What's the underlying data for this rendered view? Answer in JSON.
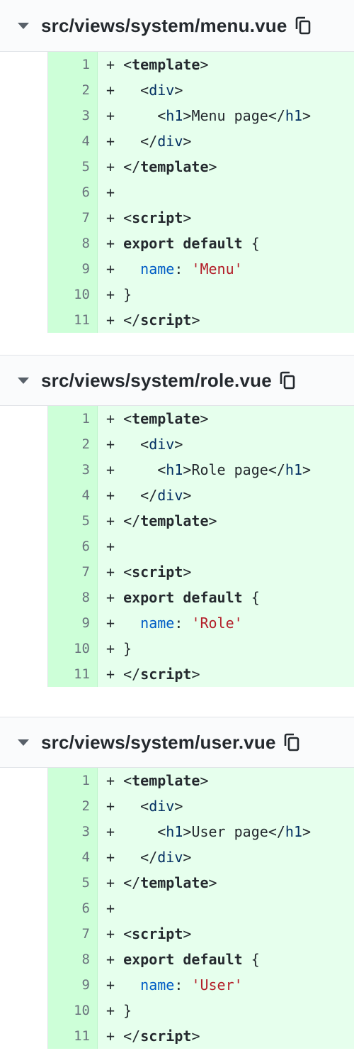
{
  "colors": {
    "added_code_bg": "#e6ffed",
    "added_gutter_bg": "#cdffd8",
    "header_bg": "#fafbfc",
    "text": "#24292e"
  },
  "files": [
    {
      "name": "src/views/system/menu.vue",
      "lines": [
        {
          "num": "1",
          "tokens": [
            [
              "plain",
              "+ "
            ],
            [
              "bracket",
              "<"
            ],
            [
              "kw",
              "template"
            ],
            [
              "bracket",
              ">"
            ]
          ]
        },
        {
          "num": "2",
          "tokens": [
            [
              "plain",
              "+   "
            ],
            [
              "bracket",
              "<"
            ],
            [
              "name",
              "div"
            ],
            [
              "bracket",
              ">"
            ]
          ]
        },
        {
          "num": "3",
          "tokens": [
            [
              "plain",
              "+     "
            ],
            [
              "bracket",
              "<"
            ],
            [
              "name",
              "h1"
            ],
            [
              "bracket",
              ">"
            ],
            [
              "plain",
              "Menu page"
            ],
            [
              "bracket",
              "</"
            ],
            [
              "name",
              "h1"
            ],
            [
              "bracket",
              ">"
            ]
          ]
        },
        {
          "num": "4",
          "tokens": [
            [
              "plain",
              "+   "
            ],
            [
              "bracket",
              "</"
            ],
            [
              "name",
              "div"
            ],
            [
              "bracket",
              ">"
            ]
          ]
        },
        {
          "num": "5",
          "tokens": [
            [
              "plain",
              "+ "
            ],
            [
              "bracket",
              "</"
            ],
            [
              "kw",
              "template"
            ],
            [
              "bracket",
              ">"
            ]
          ]
        },
        {
          "num": "6",
          "tokens": [
            [
              "plain",
              "+"
            ]
          ]
        },
        {
          "num": "7",
          "tokens": [
            [
              "plain",
              "+ "
            ],
            [
              "bracket",
              "<"
            ],
            [
              "kw",
              "script"
            ],
            [
              "bracket",
              ">"
            ]
          ]
        },
        {
          "num": "8",
          "tokens": [
            [
              "plain",
              "+ "
            ],
            [
              "kw",
              "export default"
            ],
            [
              "plain",
              " {"
            ]
          ]
        },
        {
          "num": "9",
          "tokens": [
            [
              "plain",
              "+   "
            ],
            [
              "prop",
              "name"
            ],
            [
              "plain",
              ": "
            ],
            [
              "str",
              "'Menu'"
            ]
          ]
        },
        {
          "num": "10",
          "tokens": [
            [
              "plain",
              "+ }"
            ]
          ]
        },
        {
          "num": "11",
          "tokens": [
            [
              "plain",
              "+ "
            ],
            [
              "bracket",
              "</"
            ],
            [
              "kw",
              "script"
            ],
            [
              "bracket",
              ">"
            ]
          ]
        }
      ]
    },
    {
      "name": "src/views/system/role.vue",
      "lines": [
        {
          "num": "1",
          "tokens": [
            [
              "plain",
              "+ "
            ],
            [
              "bracket",
              "<"
            ],
            [
              "kw",
              "template"
            ],
            [
              "bracket",
              ">"
            ]
          ]
        },
        {
          "num": "2",
          "tokens": [
            [
              "plain",
              "+   "
            ],
            [
              "bracket",
              "<"
            ],
            [
              "name",
              "div"
            ],
            [
              "bracket",
              ">"
            ]
          ]
        },
        {
          "num": "3",
          "tokens": [
            [
              "plain",
              "+     "
            ],
            [
              "bracket",
              "<"
            ],
            [
              "name",
              "h1"
            ],
            [
              "bracket",
              ">"
            ],
            [
              "plain",
              "Role page"
            ],
            [
              "bracket",
              "</"
            ],
            [
              "name",
              "h1"
            ],
            [
              "bracket",
              ">"
            ]
          ]
        },
        {
          "num": "4",
          "tokens": [
            [
              "plain",
              "+   "
            ],
            [
              "bracket",
              "</"
            ],
            [
              "name",
              "div"
            ],
            [
              "bracket",
              ">"
            ]
          ]
        },
        {
          "num": "5",
          "tokens": [
            [
              "plain",
              "+ "
            ],
            [
              "bracket",
              "</"
            ],
            [
              "kw",
              "template"
            ],
            [
              "bracket",
              ">"
            ]
          ]
        },
        {
          "num": "6",
          "tokens": [
            [
              "plain",
              "+"
            ]
          ]
        },
        {
          "num": "7",
          "tokens": [
            [
              "plain",
              "+ "
            ],
            [
              "bracket",
              "<"
            ],
            [
              "kw",
              "script"
            ],
            [
              "bracket",
              ">"
            ]
          ]
        },
        {
          "num": "8",
          "tokens": [
            [
              "plain",
              "+ "
            ],
            [
              "kw",
              "export default"
            ],
            [
              "plain",
              " {"
            ]
          ]
        },
        {
          "num": "9",
          "tokens": [
            [
              "plain",
              "+   "
            ],
            [
              "prop",
              "name"
            ],
            [
              "plain",
              ": "
            ],
            [
              "str",
              "'Role'"
            ]
          ]
        },
        {
          "num": "10",
          "tokens": [
            [
              "plain",
              "+ }"
            ]
          ]
        },
        {
          "num": "11",
          "tokens": [
            [
              "plain",
              "+ "
            ],
            [
              "bracket",
              "</"
            ],
            [
              "kw",
              "script"
            ],
            [
              "bracket",
              ">"
            ]
          ]
        }
      ]
    },
    {
      "name": "src/views/system/user.vue",
      "lines": [
        {
          "num": "1",
          "tokens": [
            [
              "plain",
              "+ "
            ],
            [
              "bracket",
              "<"
            ],
            [
              "kw",
              "template"
            ],
            [
              "bracket",
              ">"
            ]
          ]
        },
        {
          "num": "2",
          "tokens": [
            [
              "plain",
              "+   "
            ],
            [
              "bracket",
              "<"
            ],
            [
              "name",
              "div"
            ],
            [
              "bracket",
              ">"
            ]
          ]
        },
        {
          "num": "3",
          "tokens": [
            [
              "plain",
              "+     "
            ],
            [
              "bracket",
              "<"
            ],
            [
              "name",
              "h1"
            ],
            [
              "bracket",
              ">"
            ],
            [
              "plain",
              "User page"
            ],
            [
              "bracket",
              "</"
            ],
            [
              "name",
              "h1"
            ],
            [
              "bracket",
              ">"
            ]
          ]
        },
        {
          "num": "4",
          "tokens": [
            [
              "plain",
              "+   "
            ],
            [
              "bracket",
              "</"
            ],
            [
              "name",
              "div"
            ],
            [
              "bracket",
              ">"
            ]
          ]
        },
        {
          "num": "5",
          "tokens": [
            [
              "plain",
              "+ "
            ],
            [
              "bracket",
              "</"
            ],
            [
              "kw",
              "template"
            ],
            [
              "bracket",
              ">"
            ]
          ]
        },
        {
          "num": "6",
          "tokens": [
            [
              "plain",
              "+"
            ]
          ]
        },
        {
          "num": "7",
          "tokens": [
            [
              "plain",
              "+ "
            ],
            [
              "bracket",
              "<"
            ],
            [
              "kw",
              "script"
            ],
            [
              "bracket",
              ">"
            ]
          ]
        },
        {
          "num": "8",
          "tokens": [
            [
              "plain",
              "+ "
            ],
            [
              "kw",
              "export default"
            ],
            [
              "plain",
              " {"
            ]
          ]
        },
        {
          "num": "9",
          "tokens": [
            [
              "plain",
              "+   "
            ],
            [
              "prop",
              "name"
            ],
            [
              "plain",
              ": "
            ],
            [
              "str",
              "'User'"
            ]
          ]
        },
        {
          "num": "10",
          "tokens": [
            [
              "plain",
              "+ }"
            ]
          ]
        },
        {
          "num": "11",
          "tokens": [
            [
              "plain",
              "+ "
            ],
            [
              "bracket",
              "</"
            ],
            [
              "kw",
              "script"
            ],
            [
              "bracket",
              ">"
            ]
          ]
        }
      ]
    }
  ],
  "icons": {
    "collapse": "chevron-down-icon",
    "copy": "copy-icon"
  }
}
